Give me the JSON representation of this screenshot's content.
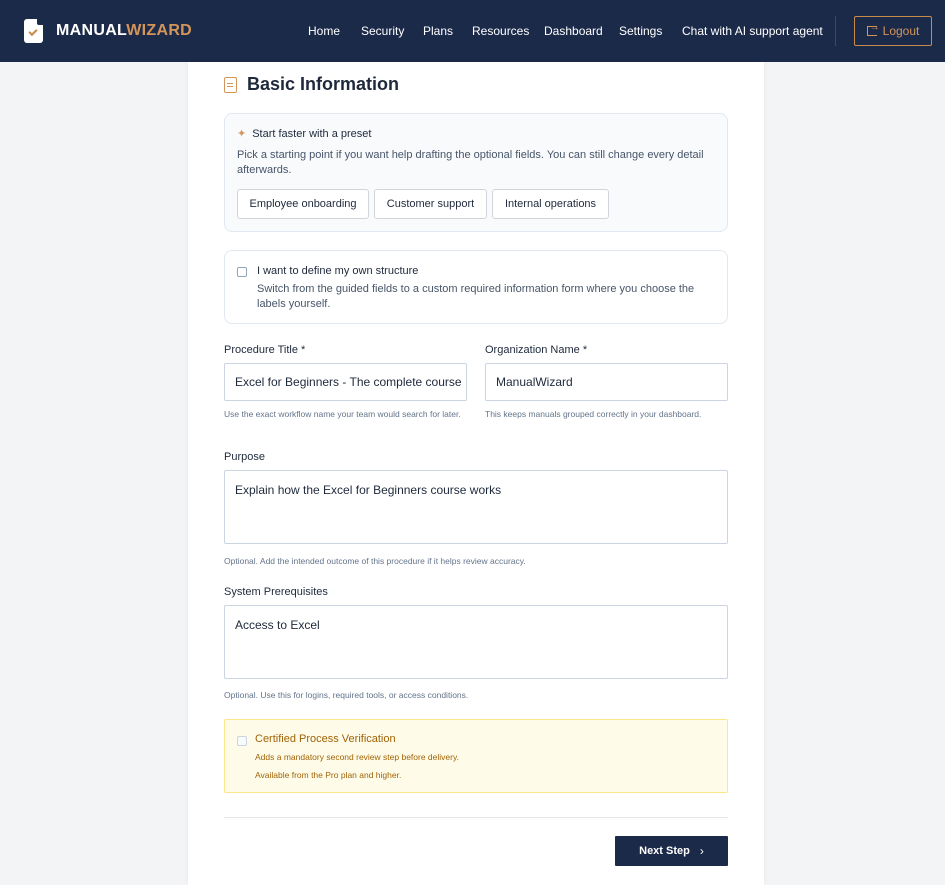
{
  "app": {
    "brand_part1": "MANUAL",
    "brand_part2": "WIZARD"
  },
  "nav": {
    "items": [
      "Home",
      "Security",
      "Plans",
      "Resources",
      "Dashboard",
      "Settings",
      "Chat with AI support agent"
    ],
    "logout_label": "Logout"
  },
  "section": {
    "title": "Basic Information"
  },
  "preset": {
    "title": "Start faster with a preset",
    "description": "Pick a starting point if you want help drafting the optional fields. You can still change every detail afterwards.",
    "buttons": [
      "Employee onboarding",
      "Customer support",
      "Internal operations"
    ]
  },
  "own_structure": {
    "checked": false,
    "title": "I want to define my own structure",
    "description": "Switch from the guided fields to a custom required information form where you choose the labels yourself."
  },
  "fields": {
    "procedure_title": {
      "label": "Procedure Title *",
      "value": "Excel for Beginners - The complete course",
      "hint": "Use the exact workflow name your team would search for later."
    },
    "organization_name": {
      "label": "Organization Name *",
      "value": "ManualWizard",
      "hint": "This keeps manuals grouped correctly in your dashboard."
    },
    "purpose": {
      "label": "Purpose",
      "value": "Explain how the Excel for Beginners course works",
      "hint": "Optional. Add the intended outcome of this procedure if it helps review accuracy."
    },
    "system_prerequisites": {
      "label": "System Prerequisites",
      "value": "Access to Excel",
      "hint": "Optional. Use this for logins, required tools, or access conditions."
    }
  },
  "certified": {
    "checked": false,
    "disabled": true,
    "title": "Certified Process Verification",
    "line1": "Adds a mandatory second review step before delivery.",
    "line2": "Available from the Pro plan and higher."
  },
  "footer": {
    "next_label": "Next Step"
  },
  "colors": {
    "navy": "#1c2a4a",
    "accent": "#d4955a",
    "warning_bg": "#fefce8"
  }
}
